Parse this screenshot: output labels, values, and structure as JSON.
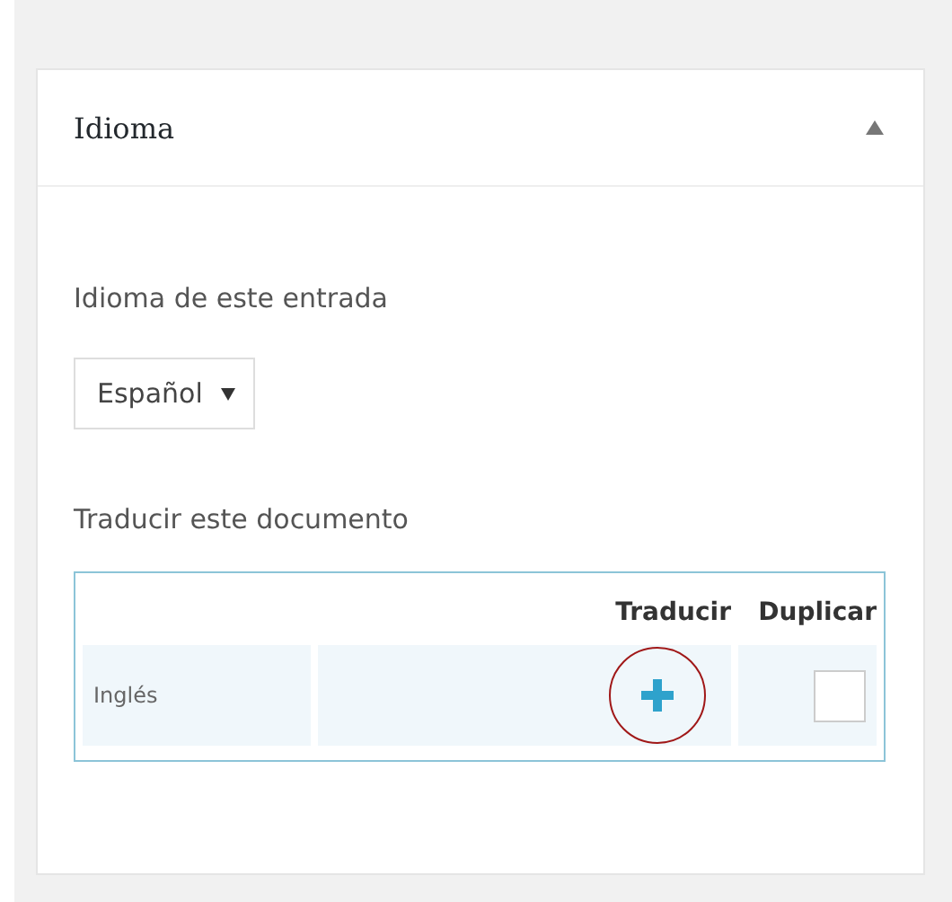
{
  "panel": {
    "title": "Idioma",
    "expanded": true
  },
  "language_label": "Idioma de este entrada",
  "language_select": {
    "value": "Español"
  },
  "translate_label": "Traducir este documento",
  "table": {
    "columns": [
      "Traducir",
      "Duplicar"
    ],
    "rows": [
      {
        "language": "Inglés",
        "duplicate_checked": false,
        "highlighted": true
      }
    ]
  }
}
